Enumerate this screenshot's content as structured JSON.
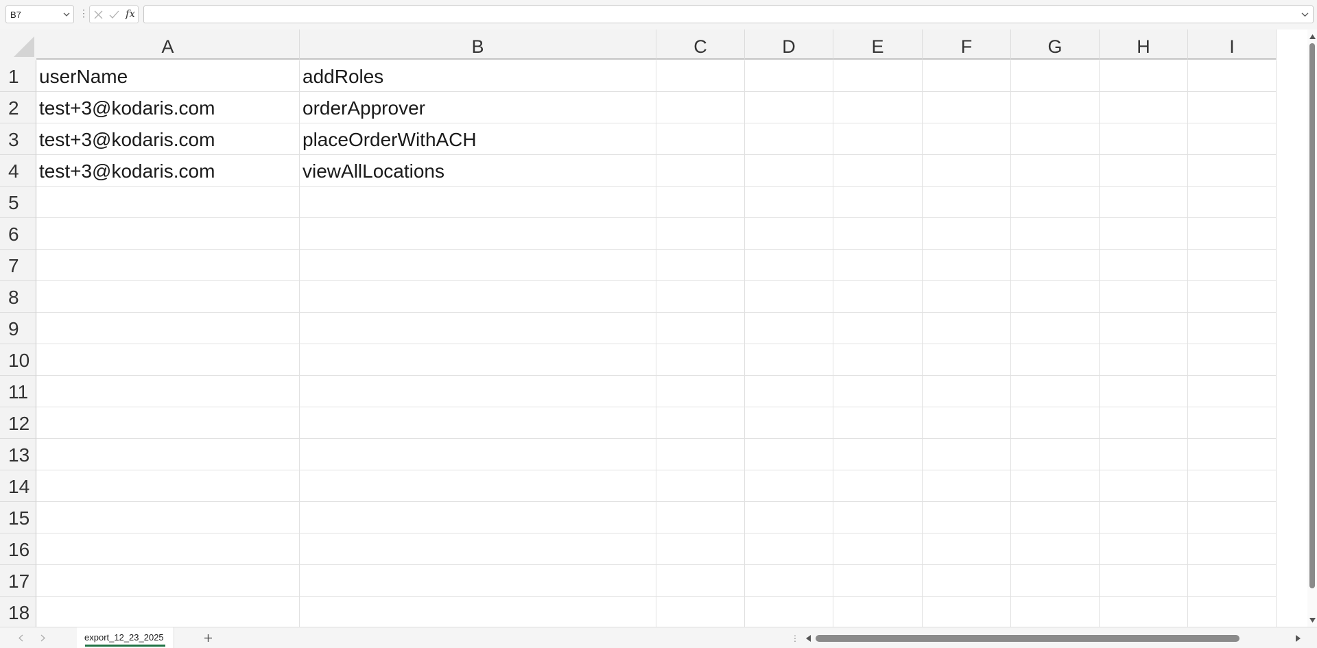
{
  "formula_bar": {
    "name_box": "B7",
    "formula_value": "",
    "fx_label": "fx"
  },
  "columns": [
    "A",
    "B",
    "C",
    "D",
    "E",
    "F",
    "G",
    "H",
    "I"
  ],
  "rows": [
    "1",
    "2",
    "3",
    "4",
    "5",
    "6",
    "7",
    "8",
    "9",
    "10",
    "11",
    "12",
    "13",
    "14",
    "15",
    "16",
    "17",
    "18"
  ],
  "cells": [
    [
      "userName",
      "addRoles"
    ],
    [
      "test+3@kodaris.com",
      "orderApprover"
    ],
    [
      "test+3@kodaris.com",
      "placeOrderWithACH"
    ],
    [
      "test+3@kodaris.com",
      "viewAllLocations"
    ]
  ],
  "sheet_tabs": [
    {
      "label": "export_12_23_2025",
      "active": true
    }
  ],
  "colors": {
    "accent": "#217346",
    "header_bg": "#f3f3f3",
    "gridline": "#e1e1e1"
  },
  "icons": {
    "name_box_dropdown": "chevron-down-icon",
    "cancel": "close-icon",
    "enter": "check-icon",
    "formula_expand": "chevron-down-icon",
    "add_sheet": "plus-icon"
  }
}
